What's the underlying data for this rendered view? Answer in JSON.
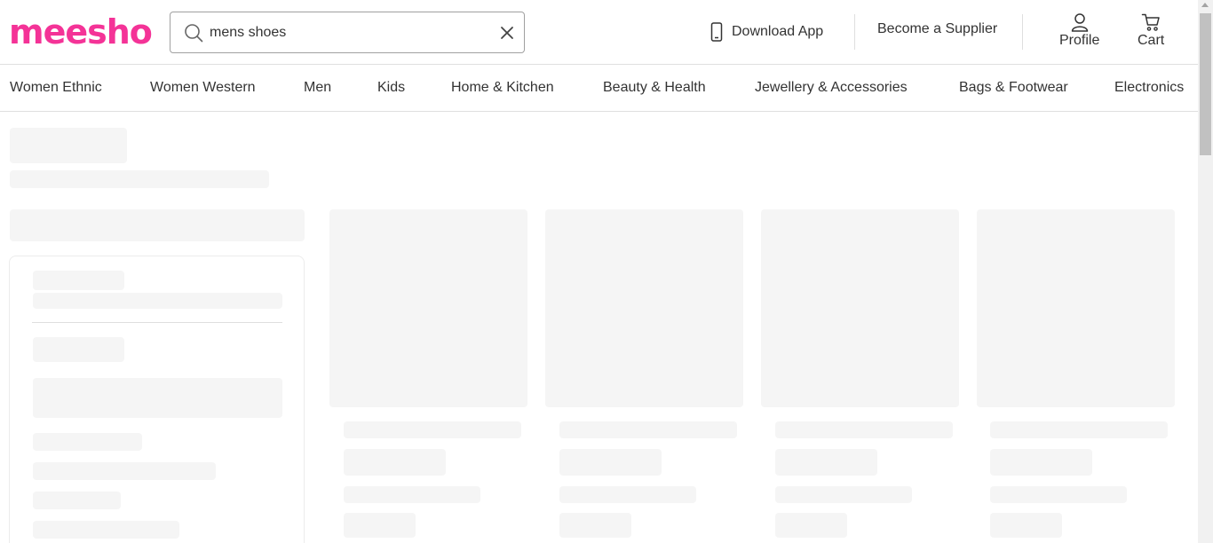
{
  "brand": {
    "logo_text": "meesho",
    "accent_color": "#f43397"
  },
  "search": {
    "value": "mens shoes",
    "search_icon": "search-icon",
    "clear_icon": "close-icon"
  },
  "header_actions": {
    "download_app": {
      "label": "Download App",
      "icon": "mobile-phone-icon"
    },
    "supplier": {
      "label": "Become a Supplier"
    },
    "profile": {
      "label": "Profile",
      "icon": "user-icon"
    },
    "cart": {
      "label": "Cart",
      "icon": "cart-icon"
    }
  },
  "categories": [
    "Women Ethnic",
    "Women Western",
    "Men",
    "Kids",
    "Home & Kitchen",
    "Beauty & Health",
    "Jewellery & Accessories",
    "Bags & Footwear",
    "Electronics"
  ],
  "loading_state": {
    "skeleton_color": "#f5f5f5",
    "product_placeholders": 4
  }
}
